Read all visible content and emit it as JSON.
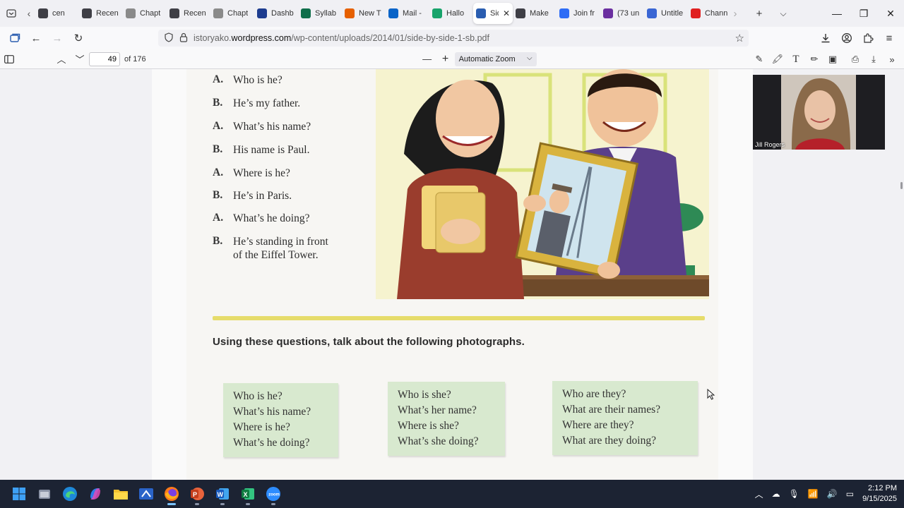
{
  "browser": {
    "tabs": [
      {
        "label": "cen",
        "icon": "wordpress-icon",
        "color": "#3f3f46"
      },
      {
        "label": "Recen",
        "icon": "wordpress-icon",
        "color": "#3f3f46"
      },
      {
        "label": "Chapt",
        "icon": "dotted-page-icon",
        "color": "#8a8a8a"
      },
      {
        "label": "Recen",
        "icon": "wordpress-icon",
        "color": "#3f3f46"
      },
      {
        "label": "Chapt",
        "icon": "dotted-page-icon",
        "color": "#8a8a8a"
      },
      {
        "label": "Dashb",
        "icon": "dashboard-icon",
        "color": "#1d3c8f"
      },
      {
        "label": "Syllab",
        "icon": "dfc-icon",
        "color": "#0f6e4a"
      },
      {
        "label": "New T",
        "icon": "firefox-icon",
        "color": "#e66000"
      },
      {
        "label": "Mail -",
        "icon": "outlook-icon",
        "color": "#0a64c8"
      },
      {
        "label": "Hallo",
        "icon": "vector-icon",
        "color": "#18a36b"
      },
      {
        "label": "Sid",
        "icon": "wordpress-icon",
        "color": "#2a5db0",
        "active": true
      },
      {
        "label": "Make",
        "icon": "wordpress-icon",
        "color": "#3f3f46"
      },
      {
        "label": "Join fr",
        "icon": "zoom-icon",
        "color": "#2d6cf6"
      },
      {
        "label": "(73 un",
        "icon": "mail-icon",
        "color": "#6b2fa0"
      },
      {
        "label": "Untitle",
        "icon": "docs-icon",
        "color": "#3a66d4"
      },
      {
        "label": "Chann",
        "icon": "youtube-icon",
        "color": "#e02020"
      }
    ],
    "url_host": "istoryako.",
    "url_domain": "wordpress.com",
    "url_path": "/wp-content/uploads/2014/01/side-by-side-1-sb.pdf"
  },
  "pdf": {
    "page_number": "49",
    "page_total": "of 176",
    "zoom": "Automatic Zoom"
  },
  "document": {
    "dialog": [
      {
        "speaker": "A.",
        "line1": "Who is he?",
        "line2": ""
      },
      {
        "speaker": "B.",
        "line1": "He’s my father.",
        "line2": ""
      },
      {
        "speaker": "A.",
        "line1": "What’s his name?",
        "line2": ""
      },
      {
        "speaker": "B.",
        "line1": "His name is Paul.",
        "line2": ""
      },
      {
        "speaker": "A.",
        "line1": "Where is he?",
        "line2": ""
      },
      {
        "speaker": "B.",
        "line1": "He’s in Paris.",
        "line2": ""
      },
      {
        "speaker": "A.",
        "line1": "What’s he doing?",
        "line2": ""
      },
      {
        "speaker": "B.",
        "line1": "He’s standing in front",
        "line2": "of the Eiffel Tower."
      }
    ],
    "instruction": "Using these questions, talk about the following photographs.",
    "question_boxes": [
      {
        "lines": [
          "Who is he?",
          "What’s his name?",
          "Where is he?",
          "What’s he doing?"
        ]
      },
      {
        "lines": [
          "Who is she?",
          "What’s her name?",
          "Where is she?",
          "What’s she doing?"
        ]
      },
      {
        "lines": [
          "Who are they?",
          "What are their names?",
          "Where are they?",
          "What are they doing?"
        ]
      }
    ],
    "colors": {
      "question_box": "#d8e9cf",
      "divider": "#e6dc6a"
    }
  },
  "video": {
    "participant_name": "Jill Rogers"
  },
  "taskbar": {
    "time": "2:12 PM",
    "date": "9/15/2025",
    "apps": [
      "windows-start-icon",
      "file-window-icon",
      "edge-icon",
      "copilot-icon",
      "file-explorer-icon",
      "snipping-tool-icon",
      "firefox-icon",
      "powerpoint-icon",
      "word-icon",
      "excel-icon",
      "zoom-icon"
    ]
  }
}
